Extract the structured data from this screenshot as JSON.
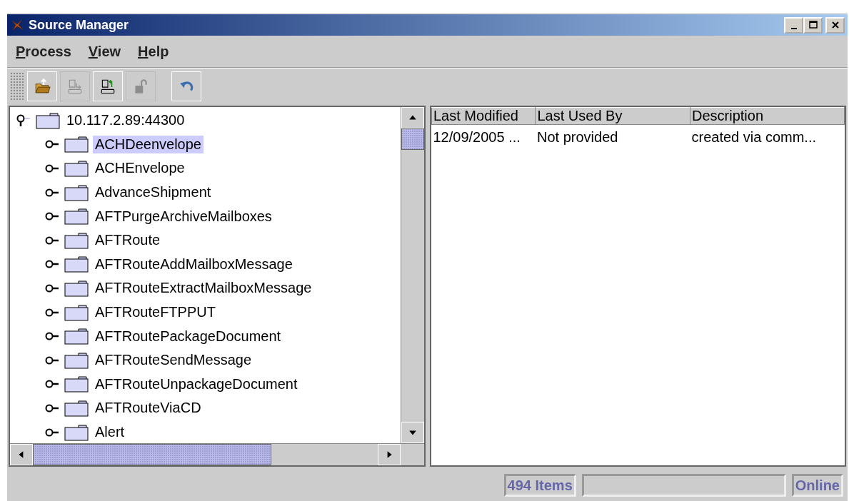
{
  "window": {
    "title": "Source Manager"
  },
  "menu": [
    {
      "label": "Process"
    },
    {
      "label": "View"
    },
    {
      "label": "Help"
    }
  ],
  "toolbar": [
    {
      "kind": "open",
      "disabled": false
    },
    {
      "kind": "checkout",
      "disabled": true
    },
    {
      "kind": "checkin",
      "disabled": false
    },
    {
      "kind": "unlock",
      "disabled": true
    },
    {
      "kind": "undo",
      "disabled": false
    }
  ],
  "tree": {
    "label": "10.117.2.89:44300",
    "expanded": true,
    "children": [
      {
        "label": "ACHDeenvelope",
        "expanded": false,
        "selected": true
      },
      {
        "label": "ACHEnvelope",
        "expanded": false,
        "selected": false
      },
      {
        "label": "AdvanceShipment",
        "expanded": false,
        "selected": false
      },
      {
        "label": "AFTPurgeArchiveMailboxes",
        "expanded": false,
        "selected": false
      },
      {
        "label": "AFTRoute",
        "expanded": false,
        "selected": false
      },
      {
        "label": "AFTRouteAddMailboxMessage",
        "expanded": false,
        "selected": false
      },
      {
        "label": "AFTRouteExtractMailboxMessage",
        "expanded": false,
        "selected": false
      },
      {
        "label": "AFTRouteFTPPUT",
        "expanded": false,
        "selected": false
      },
      {
        "label": "AFTRoutePackageDocument",
        "expanded": false,
        "selected": false
      },
      {
        "label": "AFTRouteSendMessage",
        "expanded": false,
        "selected": false
      },
      {
        "label": "AFTRouteUnpackageDocument",
        "expanded": false,
        "selected": false
      },
      {
        "label": "AFTRouteViaCD",
        "expanded": false,
        "selected": false
      },
      {
        "label": "Alert",
        "expanded": false,
        "selected": false
      }
    ]
  },
  "table": {
    "columns": [
      "Last Modified",
      "Last Used By",
      "Description"
    ],
    "rows": [
      [
        "12/09/2005 ...",
        "Not provided",
        "created via comm..."
      ]
    ]
  },
  "status_bar": {
    "count": "494 Items",
    "state": "Online"
  }
}
